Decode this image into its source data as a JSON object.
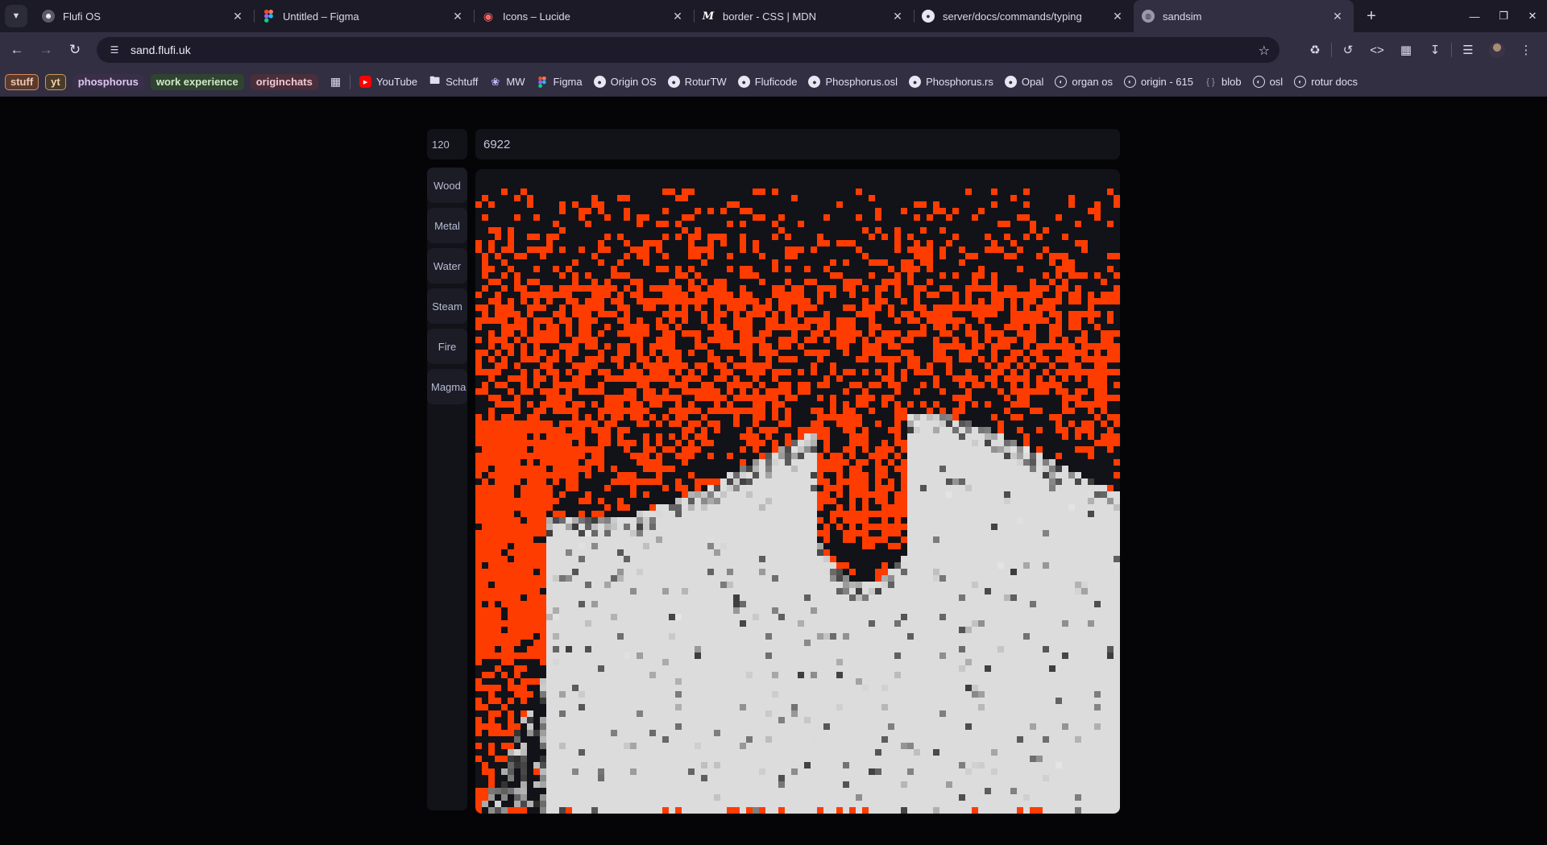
{
  "browser": {
    "tabs": [
      {
        "title": "Flufi OS",
        "icon": "flufi-icon",
        "active": false
      },
      {
        "title": "Untitled – Figma",
        "icon": "figma-icon",
        "active": false
      },
      {
        "title": "Icons – Lucide",
        "icon": "lucide-icon",
        "active": false
      },
      {
        "title": "border - CSS | MDN",
        "icon": "mdn-icon",
        "active": false
      },
      {
        "title": "server/docs/commands/typing",
        "icon": "github-icon",
        "active": false
      },
      {
        "title": "sandsim",
        "icon": "globe-icon",
        "active": true
      }
    ],
    "url": "sand.flufi.uk",
    "bookmarks": {
      "tags": [
        {
          "label": "stuff",
          "bg": "#5a3a2c",
          "color": "#f0c9b3",
          "border": "#d98a62"
        },
        {
          "label": "yt",
          "bg": "#4a3a2a",
          "color": "#f2d4a8",
          "border": "#c89a5c"
        },
        {
          "label": "phosphorus",
          "bg": "#3a2f48",
          "color": "#dcc8f2",
          "border": "#3a2f48"
        },
        {
          "label": "work experience",
          "bg": "#2f4430",
          "color": "#cfe8c6",
          "border": "#2f4430"
        },
        {
          "label": "originchats",
          "bg": "#4a2e3a",
          "color": "#f2c9d6",
          "border": "#4a2e3a"
        }
      ],
      "items": [
        {
          "label": "YouTube",
          "icon": "youtube-icon"
        },
        {
          "label": "Schtuff",
          "icon": "folder-icon"
        },
        {
          "label": "MW",
          "icon": "mw-icon"
        },
        {
          "label": "Figma",
          "icon": "figma-icon"
        },
        {
          "label": "Origin OS",
          "icon": "github-icon"
        },
        {
          "label": "RoturTW",
          "icon": "github-icon"
        },
        {
          "label": "Fluficode",
          "icon": "github-icon"
        },
        {
          "label": "Phosphorus.osl",
          "icon": "github-icon"
        },
        {
          "label": "Phosphorus.rs",
          "icon": "github-icon"
        },
        {
          "label": "Opal",
          "icon": "github-icon"
        },
        {
          "label": "organ os",
          "icon": "rotur-icon"
        },
        {
          "label": "origin - 615",
          "icon": "rotur-icon"
        },
        {
          "label": "blob",
          "icon": "braces-icon"
        },
        {
          "label": "osl",
          "icon": "rotur-icon"
        },
        {
          "label": "rotur docs",
          "icon": "rotur-icon"
        }
      ]
    }
  },
  "app": {
    "brush_size": "120",
    "particle_count": "6922",
    "materials": [
      "Wood",
      "Metal",
      "Water",
      "Steam",
      "Fire",
      "Magma"
    ],
    "colors": {
      "fire": "#ff3c00",
      "steam": "#dcdcdc",
      "background": "#121219"
    }
  }
}
